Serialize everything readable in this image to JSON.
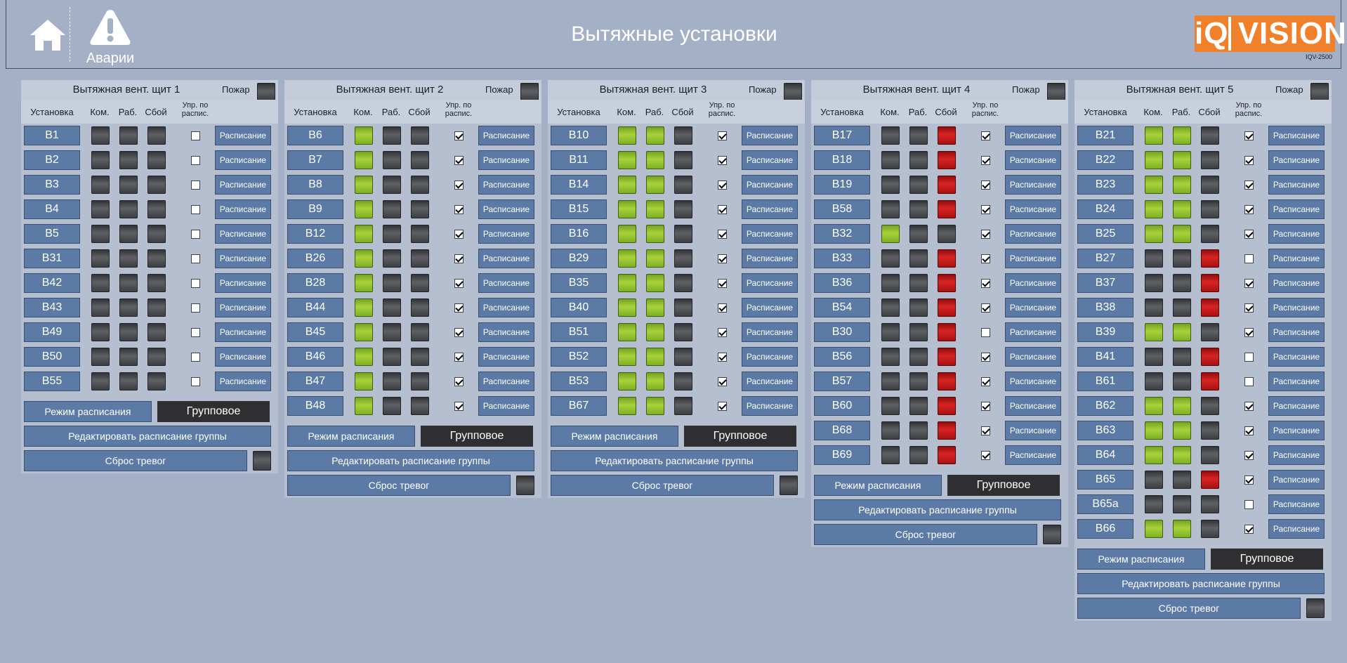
{
  "header": {
    "title": "Вытяжные установки",
    "alarm_label": "Аварии",
    "logo_left": "iQ",
    "logo_right": "VISION",
    "logo_sub": "IQV-2500"
  },
  "colors": {
    "on": "#a9d23a",
    "fault": "#d82424",
    "off": "#4a4b4f",
    "button": "#5b7ba6",
    "panel": "#b6bfd0"
  },
  "labels": {
    "fire": "Пожар",
    "col_unit": "Установка",
    "col_cmd": "Ком.",
    "col_run": "Раб.",
    "col_fault": "Сбой",
    "col_sched_ctrl": "Упр. по распис.",
    "schedule_btn": "Расписание",
    "schedule_mode": "Режим расписания",
    "group_mode": "Групповое",
    "edit_group_schedule": "Редактировать расписание группы",
    "reset_alarms": "Сброс тревог"
  },
  "panels": [
    {
      "title": "Вытяжная вент. щит 1",
      "rows": [
        {
          "name": "В1",
          "cmd": "off",
          "run": "off",
          "fault": "off",
          "sched": false
        },
        {
          "name": "В2",
          "cmd": "off",
          "run": "off",
          "fault": "off",
          "sched": false
        },
        {
          "name": "В3",
          "cmd": "off",
          "run": "off",
          "fault": "off",
          "sched": false
        },
        {
          "name": "В4",
          "cmd": "off",
          "run": "off",
          "fault": "off",
          "sched": false
        },
        {
          "name": "В5",
          "cmd": "off",
          "run": "off",
          "fault": "off",
          "sched": false
        },
        {
          "name": "В31",
          "cmd": "off",
          "run": "off",
          "fault": "off",
          "sched": false
        },
        {
          "name": "В42",
          "cmd": "off",
          "run": "off",
          "fault": "off",
          "sched": false
        },
        {
          "name": "В43",
          "cmd": "off",
          "run": "off",
          "fault": "off",
          "sched": false
        },
        {
          "name": "В49",
          "cmd": "off",
          "run": "off",
          "fault": "off",
          "sched": false
        },
        {
          "name": "В50",
          "cmd": "off",
          "run": "off",
          "fault": "off",
          "sched": false
        },
        {
          "name": "В55",
          "cmd": "off",
          "run": "off",
          "fault": "off",
          "sched": false
        }
      ]
    },
    {
      "title": "Вытяжная вент. щит 2",
      "rows": [
        {
          "name": "В6",
          "cmd": "green",
          "run": "off",
          "fault": "off",
          "sched": true
        },
        {
          "name": "В7",
          "cmd": "green",
          "run": "off",
          "fault": "off",
          "sched": true
        },
        {
          "name": "В8",
          "cmd": "green",
          "run": "off",
          "fault": "off",
          "sched": true
        },
        {
          "name": "В9",
          "cmd": "green",
          "run": "off",
          "fault": "off",
          "sched": true
        },
        {
          "name": "В12",
          "cmd": "green",
          "run": "off",
          "fault": "off",
          "sched": true
        },
        {
          "name": "В26",
          "cmd": "green",
          "run": "off",
          "fault": "off",
          "sched": true
        },
        {
          "name": "В28",
          "cmd": "green",
          "run": "off",
          "fault": "off",
          "sched": true
        },
        {
          "name": "В44",
          "cmd": "green",
          "run": "off",
          "fault": "off",
          "sched": true
        },
        {
          "name": "В45",
          "cmd": "green",
          "run": "off",
          "fault": "off",
          "sched": true
        },
        {
          "name": "В46",
          "cmd": "green",
          "run": "off",
          "fault": "off",
          "sched": true
        },
        {
          "name": "В47",
          "cmd": "green",
          "run": "off",
          "fault": "off",
          "sched": true
        },
        {
          "name": "В48",
          "cmd": "green",
          "run": "off",
          "fault": "off",
          "sched": true
        }
      ]
    },
    {
      "title": "Вытяжная вент. щит 3",
      "rows": [
        {
          "name": "В10",
          "cmd": "green",
          "run": "green",
          "fault": "off",
          "sched": true
        },
        {
          "name": "В11",
          "cmd": "green",
          "run": "green",
          "fault": "off",
          "sched": true
        },
        {
          "name": "В14",
          "cmd": "green",
          "run": "green",
          "fault": "off",
          "sched": true
        },
        {
          "name": "В15",
          "cmd": "green",
          "run": "green",
          "fault": "off",
          "sched": true
        },
        {
          "name": "В16",
          "cmd": "green",
          "run": "green",
          "fault": "off",
          "sched": true
        },
        {
          "name": "В29",
          "cmd": "green",
          "run": "green",
          "fault": "off",
          "sched": true
        },
        {
          "name": "В35",
          "cmd": "green",
          "run": "green",
          "fault": "off",
          "sched": true
        },
        {
          "name": "В40",
          "cmd": "green",
          "run": "green",
          "fault": "off",
          "sched": true
        },
        {
          "name": "В51",
          "cmd": "green",
          "run": "green",
          "fault": "off",
          "sched": true
        },
        {
          "name": "В52",
          "cmd": "green",
          "run": "green",
          "fault": "off",
          "sched": true
        },
        {
          "name": "В53",
          "cmd": "green",
          "run": "green",
          "fault": "off",
          "sched": true
        },
        {
          "name": "В67",
          "cmd": "green",
          "run": "green",
          "fault": "off",
          "sched": true
        }
      ]
    },
    {
      "title": "Вытяжная вент. щит 4",
      "rows": [
        {
          "name": "В17",
          "cmd": "off",
          "run": "off",
          "fault": "red",
          "sched": true
        },
        {
          "name": "В18",
          "cmd": "off",
          "run": "off",
          "fault": "red",
          "sched": true
        },
        {
          "name": "В19",
          "cmd": "off",
          "run": "off",
          "fault": "red",
          "sched": true
        },
        {
          "name": "В58",
          "cmd": "off",
          "run": "off",
          "fault": "red",
          "sched": true
        },
        {
          "name": "В32",
          "cmd": "green",
          "run": "off",
          "fault": "off",
          "sched": true
        },
        {
          "name": "В33",
          "cmd": "off",
          "run": "off",
          "fault": "red",
          "sched": true
        },
        {
          "name": "В36",
          "cmd": "off",
          "run": "off",
          "fault": "red",
          "sched": true
        },
        {
          "name": "В54",
          "cmd": "off",
          "run": "off",
          "fault": "red",
          "sched": true
        },
        {
          "name": "В30",
          "cmd": "off",
          "run": "off",
          "fault": "red",
          "sched": false
        },
        {
          "name": "В56",
          "cmd": "off",
          "run": "off",
          "fault": "red",
          "sched": true
        },
        {
          "name": "В57",
          "cmd": "off",
          "run": "off",
          "fault": "red",
          "sched": true
        },
        {
          "name": "В60",
          "cmd": "off",
          "run": "off",
          "fault": "red",
          "sched": true
        },
        {
          "name": "В68",
          "cmd": "off",
          "run": "off",
          "fault": "red",
          "sched": true
        },
        {
          "name": "В69",
          "cmd": "off",
          "run": "off",
          "fault": "red",
          "sched": true
        }
      ]
    },
    {
      "title": "Вытяжная вент. щит 5",
      "rows": [
        {
          "name": "В21",
          "cmd": "green",
          "run": "green",
          "fault": "off",
          "sched": true
        },
        {
          "name": "В22",
          "cmd": "green",
          "run": "green",
          "fault": "off",
          "sched": true
        },
        {
          "name": "В23",
          "cmd": "green",
          "run": "green",
          "fault": "off",
          "sched": true
        },
        {
          "name": "В24",
          "cmd": "green",
          "run": "green",
          "fault": "off",
          "sched": true
        },
        {
          "name": "В25",
          "cmd": "green",
          "run": "green",
          "fault": "off",
          "sched": true
        },
        {
          "name": "В27",
          "cmd": "off",
          "run": "off",
          "fault": "red",
          "sched": false
        },
        {
          "name": "В37",
          "cmd": "off",
          "run": "off",
          "fault": "red",
          "sched": true
        },
        {
          "name": "В38",
          "cmd": "off",
          "run": "off",
          "fault": "red",
          "sched": true
        },
        {
          "name": "В39",
          "cmd": "green",
          "run": "green",
          "fault": "off",
          "sched": true
        },
        {
          "name": "В41",
          "cmd": "off",
          "run": "off",
          "fault": "red",
          "sched": false
        },
        {
          "name": "В61",
          "cmd": "off",
          "run": "off",
          "fault": "red",
          "sched": false
        },
        {
          "name": "В62",
          "cmd": "green",
          "run": "green",
          "fault": "off",
          "sched": true
        },
        {
          "name": "В63",
          "cmd": "green",
          "run": "green",
          "fault": "off",
          "sched": true
        },
        {
          "name": "В64",
          "cmd": "green",
          "run": "green",
          "fault": "off",
          "sched": true
        },
        {
          "name": "В65",
          "cmd": "off",
          "run": "off",
          "fault": "red",
          "sched": true
        },
        {
          "name": "В65а",
          "cmd": "off",
          "run": "off",
          "fault": "off",
          "sched": false
        },
        {
          "name": "В66",
          "cmd": "green",
          "run": "green",
          "fault": "off",
          "sched": true
        }
      ]
    }
  ]
}
